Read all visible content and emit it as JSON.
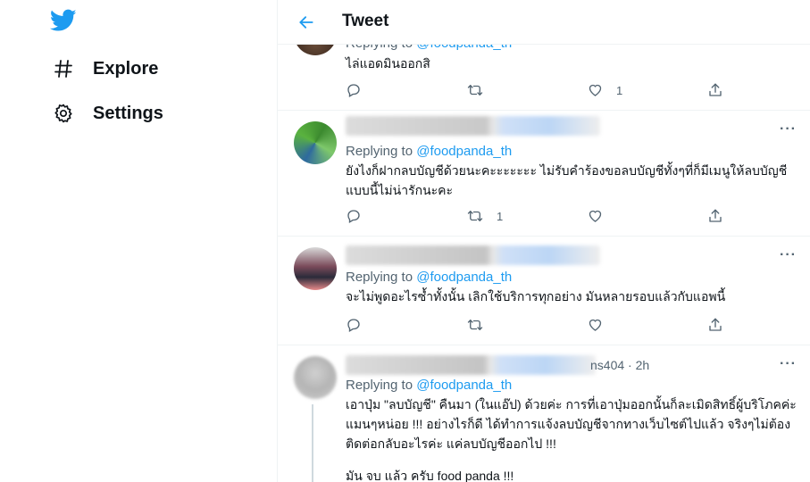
{
  "nav": {
    "logo": "twitter-bird-icon",
    "items": [
      {
        "label": "Explore",
        "icon": "hashtag-icon"
      },
      {
        "label": "Settings",
        "icon": "gear-icon"
      }
    ]
  },
  "header": {
    "title": "Tweet",
    "back_icon": "back-arrow-icon"
  },
  "accent": "#1d9bf0",
  "tweets": [
    {
      "reply_prefix": "Replying to ",
      "reply_handle": "@foodpanda_th",
      "text": "ไล่แอดมินออกสิ",
      "reply_count": "",
      "retweet_count": "",
      "like_count": "1"
    },
    {
      "reply_prefix": "Replying to ",
      "reply_handle": "@foodpanda_th",
      "text": "ยังไงก็ฝากลบบัญชีด้วยนะคะะะะะะะ ไม่รับคำร้องขอลบบัญชีทั้งๆที่ก็มีเมนูให้ลบบัญชีแบบนี้ไม่น่ารักนะคะ",
      "reply_count": "",
      "retweet_count": "1",
      "like_count": ""
    },
    {
      "reply_prefix": "Replying to ",
      "reply_handle": "@foodpanda_th",
      "text": "จะไม่พูดอะไรซ้ำทั้งนั้น เลิกใช้บริการทุกอย่าง มันหลายรอบแล้วกับแอพนี้",
      "reply_count": "",
      "retweet_count": "",
      "like_count": ""
    },
    {
      "handle_fragment": "ns404",
      "time": "· 2h",
      "reply_prefix": "Replying to ",
      "reply_handle": "@foodpanda_th",
      "text": "เอาปุ่ม \"ลบบัญชี\" คืนมา (ในแอ๊ป) ด้วยค่ะ การที่เอาปุ่มออกนั้นก็ละเมิดสิทธิ์ผู้บริโภคค่ะ แมนๆหน่อย !!! อย่างไรก็ดี ได้ทำการแจ้งลบบัญชีจากทางเว็บไซต์ไปแล้ว จริงๆไม่ต้องติดต่อกลับอะไรค่ะ แค่ลบบัญชีออกไป !!!",
      "text2": "มัน จบ แล้ว ครับ food panda !!!"
    }
  ],
  "more_label": "···"
}
